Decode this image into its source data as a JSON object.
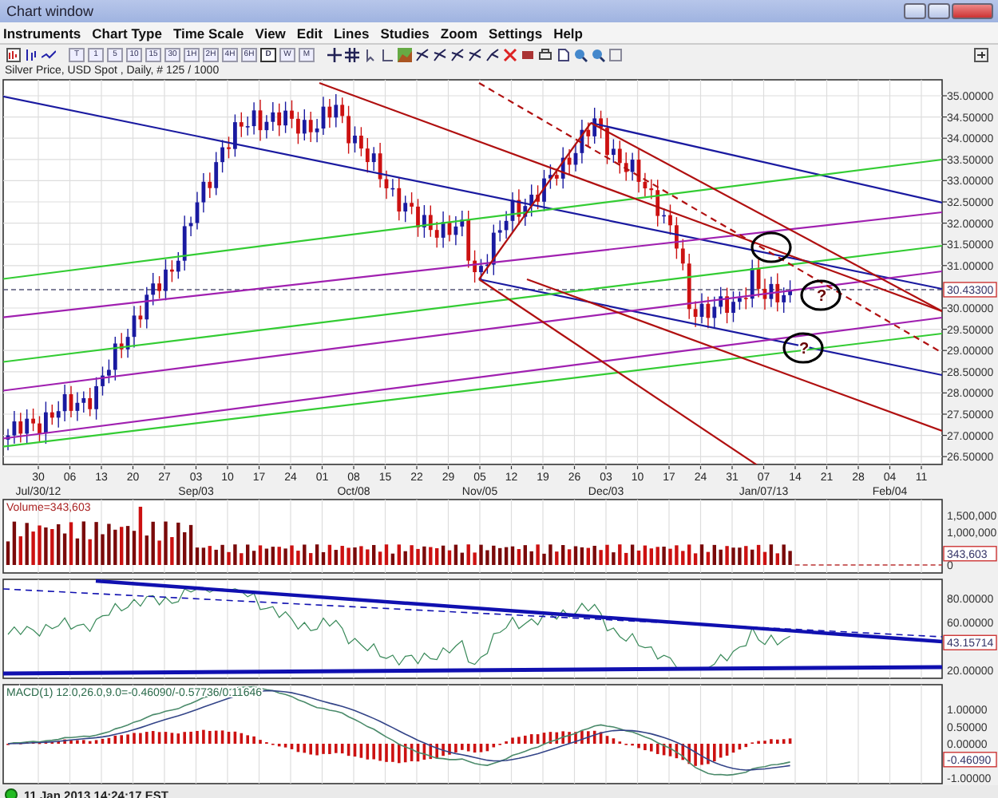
{
  "window": {
    "title": "Chart window"
  },
  "menu": [
    "Instruments",
    "Chart Type",
    "Time Scale",
    "View",
    "Edit",
    "Lines",
    "Studies",
    "Zoom",
    "Settings",
    "Help"
  ],
  "toolbar": {
    "timeframes": [
      {
        "label": "T",
        "selected": false
      },
      {
        "label": "1",
        "selected": false
      },
      {
        "label": "5",
        "selected": false
      },
      {
        "label": "10",
        "selected": false
      },
      {
        "label": "15",
        "selected": false
      },
      {
        "label": "30",
        "selected": false
      },
      {
        "label": "1H",
        "selected": false
      },
      {
        "label": "2H",
        "selected": false
      },
      {
        "label": "4H",
        "selected": false
      },
      {
        "label": "6H",
        "selected": false
      },
      {
        "label": "D",
        "selected": true
      },
      {
        "label": "W",
        "selected": false
      },
      {
        "label": "M",
        "selected": false
      }
    ]
  },
  "chart_title": "Silver Price, USD Spot , Daily, # 125 / 1000",
  "price_panel": {
    "y_labels": [
      "35.00000",
      "34.50000",
      "34.00000",
      "33.50000",
      "33.00000",
      "32.50000",
      "32.00000",
      "31.50000",
      "31.00000",
      "30.00000",
      "29.50000",
      "29.00000",
      "28.50000",
      "28.00000",
      "27.50000",
      "27.00000",
      "26.50000"
    ],
    "current": "30.43300",
    "annotations": [
      {
        "kind": "ellipse"
      },
      {
        "kind": "question",
        "text": "?"
      },
      {
        "kind": "question",
        "text": "?"
      }
    ]
  },
  "x_axis": {
    "ticks": [
      {
        "day": "30",
        "month": "Jul/30/12"
      },
      {
        "day": "06"
      },
      {
        "day": "13"
      },
      {
        "day": "20"
      },
      {
        "day": "27"
      },
      {
        "day": "03",
        "month": "Sep/03"
      },
      {
        "day": "10"
      },
      {
        "day": "17"
      },
      {
        "day": "24"
      },
      {
        "day": "01"
      },
      {
        "day": "08",
        "month": "Oct/08"
      },
      {
        "day": "15"
      },
      {
        "day": "22"
      },
      {
        "day": "29"
      },
      {
        "day": "05",
        "month": "Nov/05"
      },
      {
        "day": "12"
      },
      {
        "day": "19"
      },
      {
        "day": "26"
      },
      {
        "day": "03",
        "month": "Dec/03"
      },
      {
        "day": "10"
      },
      {
        "day": "17"
      },
      {
        "day": "24"
      },
      {
        "day": "31"
      },
      {
        "day": "07",
        "month": "Jan/07/13"
      },
      {
        "day": "14"
      },
      {
        "day": "21"
      },
      {
        "day": "28"
      },
      {
        "day": "04",
        "month": "Feb/04"
      },
      {
        "day": "11"
      }
    ]
  },
  "volume_panel": {
    "label": "Volume=343,603",
    "y_labels": [
      "1,500,000",
      "1,000,000",
      "0"
    ],
    "current": "343,603"
  },
  "rsi_panel": {
    "y_labels": [
      "80.00000",
      "60.00000",
      "20.00000"
    ],
    "current": "43.15714"
  },
  "macd_panel": {
    "label": "MACD(1) 12.0,26.0,9.0=-0.46090/-0.57736/0.11646",
    "y_labels": [
      "1.00000",
      "0.50000",
      "0.00000",
      "-1.00000"
    ],
    "current": "-0.46090"
  },
  "status_bar": {
    "text": "11 Jan 2013 14:24:17 EST"
  }
}
